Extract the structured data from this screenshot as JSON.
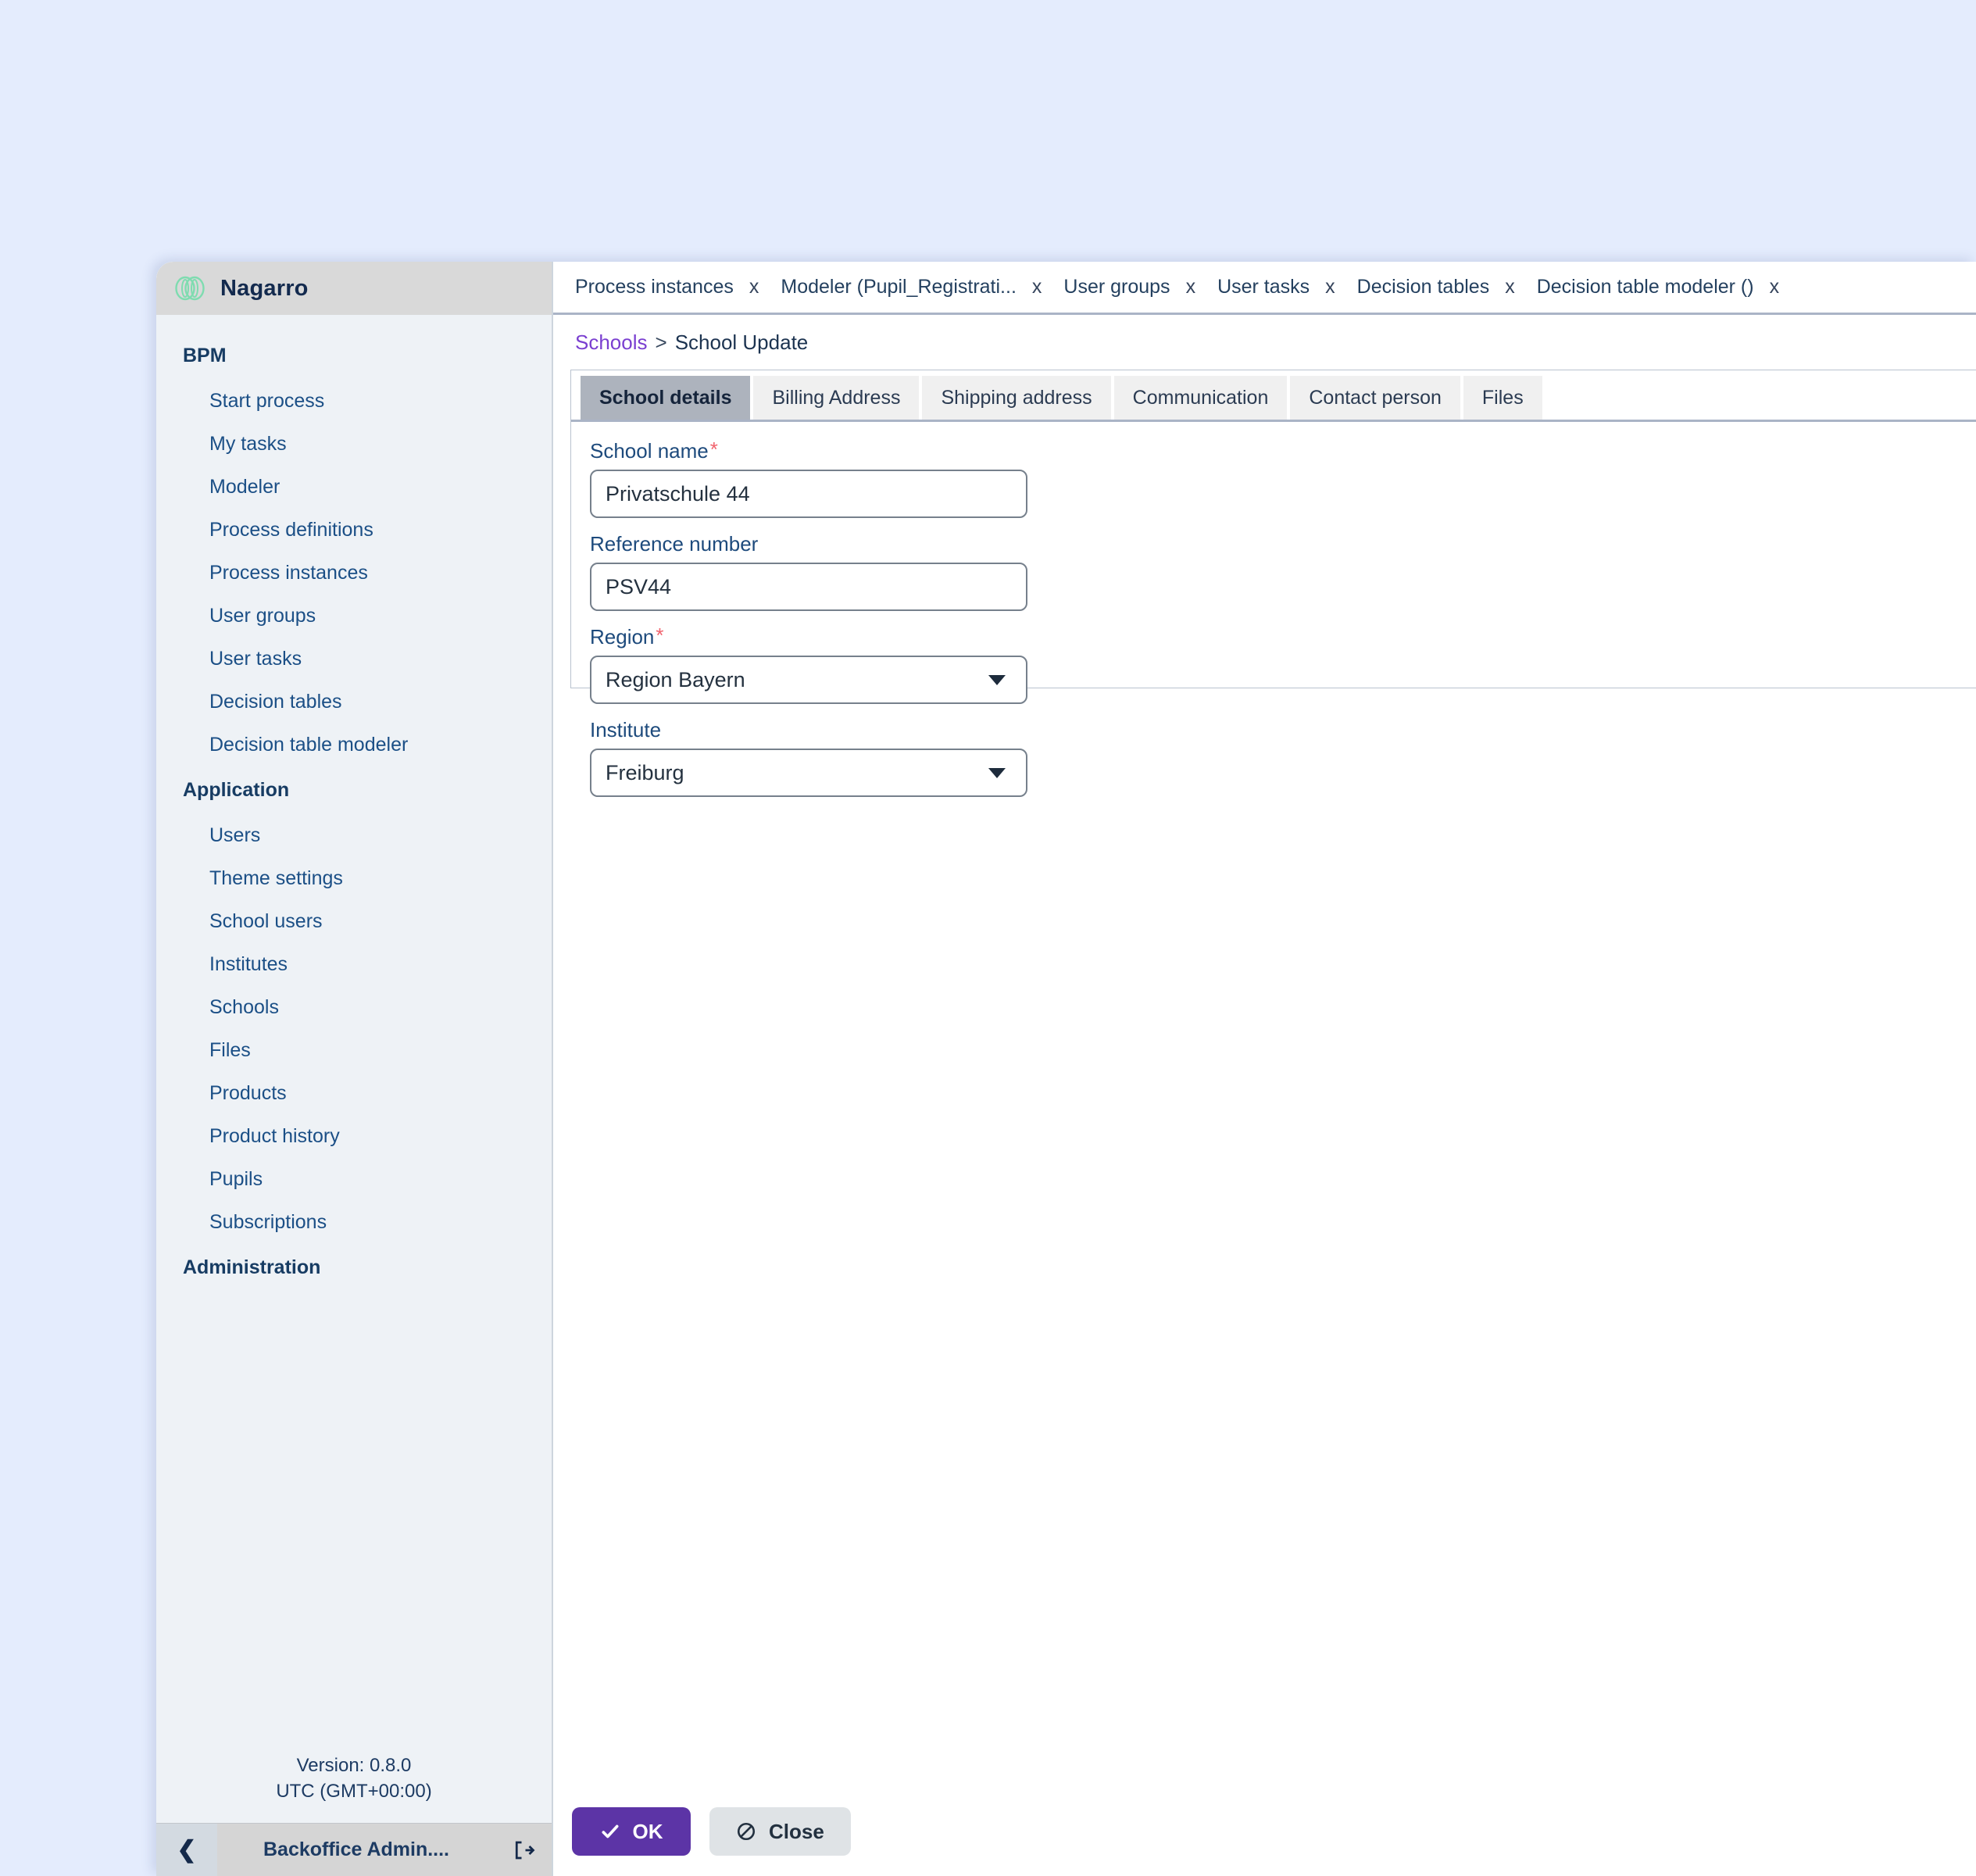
{
  "brand": {
    "name": "Nagarro",
    "logo_icon": "nagarro-loops-icon",
    "logo_color": "#7fdcb0"
  },
  "sidebar": {
    "groups": [
      {
        "title": "BPM",
        "items": [
          {
            "label": "Start process"
          },
          {
            "label": "My tasks"
          },
          {
            "label": "Modeler"
          },
          {
            "label": "Process definitions"
          },
          {
            "label": "Process instances"
          },
          {
            "label": "User groups"
          },
          {
            "label": "User tasks"
          },
          {
            "label": "Decision tables"
          },
          {
            "label": "Decision table modeler"
          }
        ]
      },
      {
        "title": "Application",
        "items": [
          {
            "label": "Users"
          },
          {
            "label": "Theme settings"
          },
          {
            "label": "School users"
          },
          {
            "label": "Institutes"
          },
          {
            "label": "Schools"
          },
          {
            "label": "Files"
          },
          {
            "label": "Products"
          },
          {
            "label": "Product history"
          },
          {
            "label": "Pupils"
          },
          {
            "label": "Subscriptions"
          }
        ]
      },
      {
        "title": "Administration",
        "items": []
      }
    ],
    "version": "Version: 0.8.0",
    "timezone": "UTC (GMT+00:00)",
    "collapse_icon": "chevron-left-icon",
    "user": "Backoffice Admin....",
    "logout_icon": "logout-icon"
  },
  "tabbar": {
    "close_glyph": "x",
    "tabs": [
      {
        "label": "Process instances"
      },
      {
        "label": "Modeler (Pupil_Registrati..."
      },
      {
        "label": "User groups"
      },
      {
        "label": "User tasks"
      },
      {
        "label": "Decision tables"
      },
      {
        "label": "Decision table modeler ()"
      }
    ]
  },
  "breadcrumb": {
    "root": "Schools",
    "separator": ">",
    "current": "School Update"
  },
  "inner_tabs": [
    {
      "label": "School details",
      "active": true
    },
    {
      "label": "Billing Address",
      "active": false
    },
    {
      "label": "Shipping address",
      "active": false
    },
    {
      "label": "Communication",
      "active": false
    },
    {
      "label": "Contact person",
      "active": false
    },
    {
      "label": "Files",
      "active": false
    }
  ],
  "form": {
    "fields": [
      {
        "label": "School name",
        "required": true,
        "type": "text",
        "value": "Privatschule 44"
      },
      {
        "label": "Reference number",
        "required": false,
        "type": "text",
        "value": "PSV44"
      },
      {
        "label": "Region",
        "required": true,
        "type": "select",
        "value": "Region Bayern"
      },
      {
        "label": "Institute",
        "required": false,
        "type": "select",
        "value": "Freiburg"
      }
    ],
    "required_marker": "*"
  },
  "actions": {
    "ok_label": "OK",
    "ok_icon": "check-icon",
    "ok_color": "#5c34a6",
    "close_label": "Close",
    "close_icon": "ban-icon"
  }
}
